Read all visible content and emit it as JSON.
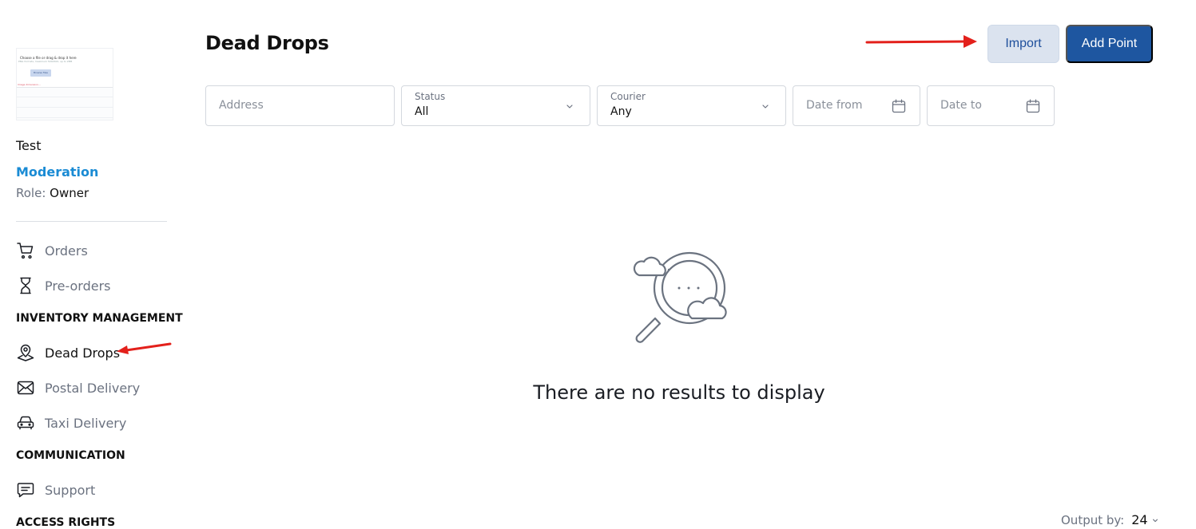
{
  "sidebar": {
    "store_name": "Test",
    "store_status": "Moderation",
    "role_label": "Role:",
    "role_value": "Owner",
    "items": {
      "orders": "Orders",
      "preorders": "Pre-orders",
      "dead_drops": "Dead Drops",
      "postal": "Postal Delivery",
      "taxi": "Taxi Delivery",
      "support": "Support"
    },
    "sections": {
      "inventory": "INVENTORY MANAGEMENT",
      "communication": "COMMUNICATION",
      "access": "ACCESS RIGHTS"
    },
    "active_item": "dead_drops"
  },
  "page": {
    "title": "Dead Drops",
    "import_label": "Import",
    "add_point_label": "Add Point"
  },
  "filters": {
    "address_placeholder": "Address",
    "status_label": "Status",
    "status_value": "All",
    "courier_label": "Courier",
    "courier_value": "Any",
    "date_from_placeholder": "Date from",
    "date_to_placeholder": "Date to"
  },
  "empty_state": {
    "message": "There are no results to display",
    "icon": "magnifier-clouds-icon"
  },
  "pagination": {
    "output_label": "Output by:",
    "output_value": "24"
  },
  "colors": {
    "accent": "#1e56a0",
    "status": "#1a8bd4",
    "annotation": "#e3201b"
  }
}
